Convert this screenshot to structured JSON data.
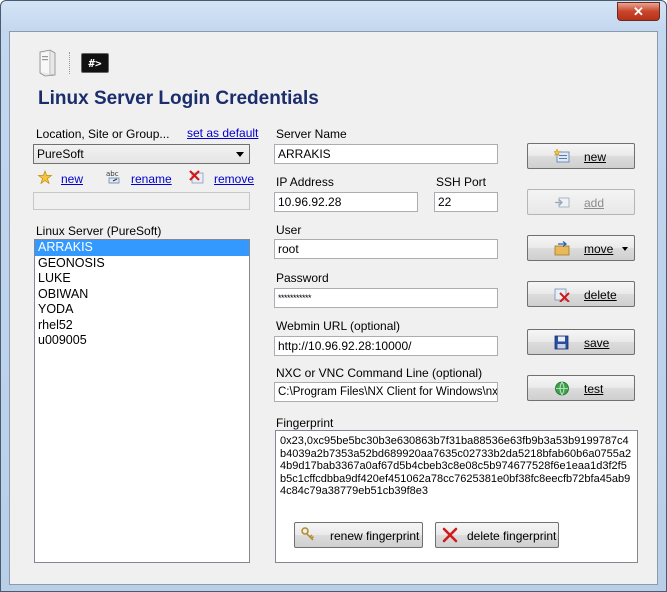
{
  "window": {
    "close_glyph": "✕"
  },
  "header": {
    "title": "Linux Server Login Credentials",
    "terminal_icon_text": "#>"
  },
  "location": {
    "label": "Location, Site or Group...",
    "set_default_link": "set as default",
    "selected": "PureSoft",
    "actions": {
      "new": "new",
      "rename": "rename",
      "remove": "remove"
    }
  },
  "server_list": {
    "label": "Linux Server (PureSoft)",
    "items": [
      "ARRAKIS",
      "GEONOSIS",
      "LUKE",
      "OBIWAN",
      "YODA",
      "rhel52",
      "u009005"
    ],
    "selected_index": 0
  },
  "form": {
    "server_name_label": "Server Name",
    "server_name": "ARRAKIS",
    "ip_label": "IP Address",
    "ip": "10.96.92.28",
    "ssh_port_label": "SSH Port",
    "ssh_port": "22",
    "user_label": "User",
    "user": "root",
    "password_label": "Password",
    "password": "***********",
    "webmin_label": "Webmin URL (optional)",
    "webmin": "http://10.96.92.28:10000/",
    "nxc_label": "NXC or VNC Command Line (optional)",
    "nxc": "C:\\Program Files\\NX Client for Windows\\nxclie",
    "fingerprint_label": "Fingerprint",
    "fingerprint": "0x23,0xc95be5bc30b3e630863b7f31ba88536e63fb9b3a53b9199787c4b4039a2b7353a52bd689920aa7635c02733b2da5218bfab60b6a0755a24b9d17bab3367a0af67d5b4cbeb3c8e08c5b974677528f6e1eaa1d3f2f5b5c1cffcdbba9df420ef451062a78cc7625381e0bf38fc8eecfb72bfa45ab94c84c79a38779eb51cb39f8e3",
    "renew_fp": "renew fingerprint",
    "delete_fp": "delete fingerprint"
  },
  "buttons": {
    "new": "new",
    "add": "add",
    "move": "move",
    "delete": "delete",
    "save": "save",
    "test": "test"
  },
  "colors": {
    "title": "#1b2d6b",
    "selection": "#3399ff",
    "link": "#0000cc"
  }
}
